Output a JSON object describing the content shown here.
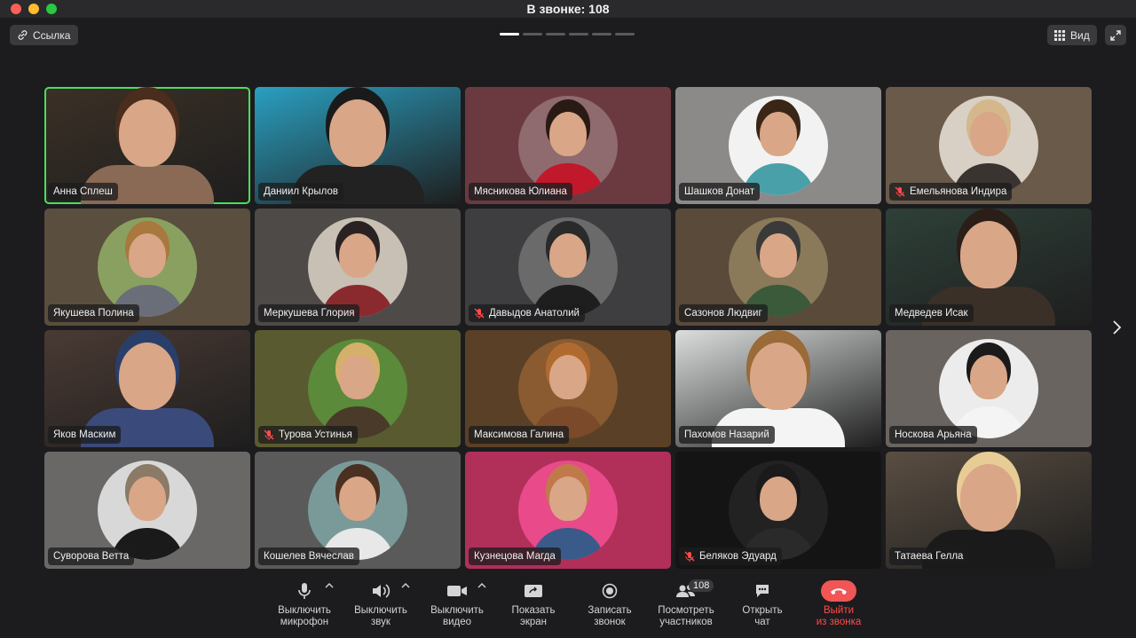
{
  "window": {
    "title": "В звонке: 108"
  },
  "header": {
    "link_label": "Ссылка",
    "view_label": "Вид",
    "pages": 6,
    "active_page": 1
  },
  "participants": [
    {
      "name": "Анна Сплеш",
      "muted": false,
      "speaking": true,
      "bg": "#3b3026",
      "shirt": "#8a6a55",
      "hair": "#4a2d1c",
      "full": true
    },
    {
      "name": "Даниил Крылов",
      "muted": false,
      "bg": "#2a9fc0",
      "shirt": "#222222",
      "hair": "#1a1a1a",
      "full": true
    },
    {
      "name": "Мясникова Юлиана",
      "muted": false,
      "bg": "#6b3a40",
      "circle": "#8f6a6e",
      "shirt": "#c2182b",
      "hair": "#2a1a14"
    },
    {
      "name": "Шашков Донат",
      "muted": false,
      "bg": "#8c8a88",
      "circle": "#f2f2f2",
      "shirt": "#4aa0a8",
      "hair": "#3a2616"
    },
    {
      "name": "Емельянова Индира",
      "muted": true,
      "bg": "#6a5a4a",
      "circle": "#d8d0c4",
      "shirt": "#3a3430",
      "hair": "#d4b88c"
    },
    {
      "name": "Якушева Полина",
      "muted": false,
      "bg": "#5a4e3e",
      "circle": "#8aa060",
      "shirt": "#6a6e78",
      "hair": "#a8783e"
    },
    {
      "name": "Меркушева Глория",
      "muted": false,
      "bg": "#4e4a48",
      "circle": "#c8c0b4",
      "shirt": "#8a2a2e",
      "hair": "#2a2222"
    },
    {
      "name": "Давыдов Анатолий",
      "muted": true,
      "bg": "#3e3e40",
      "circle": "#6a6a6a",
      "shirt": "#1e1e1e",
      "hair": "#2a2a2a"
    },
    {
      "name": "Сазонов Людвиг",
      "muted": false,
      "bg": "#5a4a3a",
      "circle": "#8a7a5a",
      "shirt": "#3a5a3a",
      "hair": "#3a3a3a"
    },
    {
      "name": "Медведев Исак",
      "muted": false,
      "bg": "#2e4038",
      "shirt": "#3a3028",
      "hair": "#2a1e16",
      "full": true
    },
    {
      "name": "Яков Маским",
      "muted": false,
      "bg": "#4a3a34",
      "shirt": "#3a4a7a",
      "hair": "#2a3e6a",
      "full": true
    },
    {
      "name": "Турова Устинья",
      "muted": true,
      "bg": "#5a5a30",
      "circle": "#5a8a3a",
      "shirt": "#4a3a2a",
      "hair": "#d4b06a"
    },
    {
      "name": "Максимова Галина",
      "muted": false,
      "bg": "#5a4026",
      "circle": "#8a5a30",
      "shirt": "#7a4a2a",
      "hair": "#b06a30"
    },
    {
      "name": "Пахомов Назарий",
      "muted": false,
      "bg": "#dcdede",
      "shirt": "#f4f4f4",
      "hair": "#9a6a38",
      "full": true
    },
    {
      "name": "Носкова Арьяна",
      "muted": false,
      "bg": "#6a6460",
      "circle": "#ececec",
      "shirt": "#f4f4f4",
      "hair": "#1a1a1a"
    },
    {
      "name": "Суворова Ветта",
      "muted": false,
      "bg": "#6a6866",
      "circle": "#d8d8d8",
      "shirt": "#1a1a1a",
      "hair": "#8a7a66"
    },
    {
      "name": "Кошелев Вячеслав",
      "muted": false,
      "bg": "#5a5a5a",
      "circle": "#7a9a9a",
      "shirt": "#e8e8e8",
      "hair": "#4a3020"
    },
    {
      "name": "Кузнецова Магда",
      "muted": false,
      "bg": "#b0305a",
      "circle": "#e84a8a",
      "shirt": "#3a5a8a",
      "hair": "#c07a4a"
    },
    {
      "name": "Беляков Эдуард",
      "muted": true,
      "bg": "#141414",
      "circle": "#222222",
      "shirt": "#2a2a2a",
      "hair": "#1a1a1a"
    },
    {
      "name": "Татаева Гелла",
      "muted": false,
      "bg": "#5a4e42",
      "shirt": "#1a1a1a",
      "hair": "#e8cc96",
      "full": true
    }
  ],
  "toolbar": {
    "mic": "Выключить\nмикрофон",
    "sound": "Выключить\nзвук",
    "video": "Выключить\nвидео",
    "share": "Показать\nэкран",
    "record": "Записать\nзвонок",
    "participants": "Посмотреть\nучастников",
    "participants_count": "108",
    "chat": "Открыть\nчат",
    "leave": "Выйти\nиз звонка"
  },
  "colors": {
    "speaking": "#4ade5a",
    "leave": "#f25555",
    "close": "#ff5f57",
    "minimize": "#febc2e",
    "maximize": "#28c840"
  }
}
